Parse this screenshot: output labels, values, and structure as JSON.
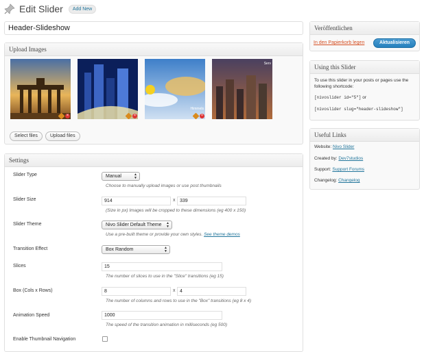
{
  "header": {
    "title": "Edit Slider",
    "add_new": "Add New"
  },
  "post_title": "Header-Slideshow",
  "upload": {
    "heading": "Upload Images",
    "select_files": "Select files",
    "upload_files": "Upload files",
    "thumb_overlay_text": [
      "Himmels",
      "Himmels",
      "Serv"
    ]
  },
  "settings": {
    "heading": "Settings",
    "slider_type": {
      "label": "Slider Type",
      "value": "Manual",
      "desc": "Choose to manually upload images or use post thumbnails"
    },
    "slider_size": {
      "label": "Slider Size",
      "width": "914",
      "height": "339",
      "desc": "(Size in px) Images will be cropped to these dimensions (eg 400 x 150)"
    },
    "slider_theme": {
      "label": "Slider Theme",
      "value": "Nivo Slider Default Theme",
      "desc": "Use a pre-built theme or provide your own styles.",
      "link": "See theme demos"
    },
    "transition": {
      "label": "Transition Effect",
      "value": "Box Random"
    },
    "slices": {
      "label": "Slices",
      "value": "15",
      "desc": "The number of slices to use in the \"Slice\" transitions (eg 15)"
    },
    "box": {
      "label": "Box (Cols x Rows)",
      "cols": "8",
      "rows": "4",
      "desc": "The number of columns and rows to use in the \"Box\" transitions (eg 8 x 4)"
    },
    "animation_speed": {
      "label": "Animation Speed",
      "value": "1000",
      "desc": "The speed of the transition animation in milliseconds (eg 500)"
    },
    "thumb_nav": {
      "label": "Enable Thumbnail Navigation"
    },
    "x_sep": "x"
  },
  "publish": {
    "heading": "Veröffentlichen",
    "trash": "In den Papierkorb legen",
    "update": "Aktualisieren"
  },
  "using": {
    "heading": "Using this Slider",
    "text": "To use this slider in your posts or pages use the following shortcode:",
    "code1": "[nivoslider id=\"5\"]",
    "or": "or",
    "code2": "[nivoslider slug=\"header-slideshow\"]"
  },
  "links": {
    "heading": "Useful Links",
    "website_label": "Website:",
    "website": "Nivo Slider",
    "created_label": "Created by:",
    "created": "Dev7studios",
    "support_label": "Support:",
    "support": "Support Forums",
    "changelog_label": "Changelog:",
    "changelog": "Changelog"
  },
  "colors": {
    "link": "#21759b",
    "trash": "#d54e21",
    "primary_button": "#2580bd"
  }
}
